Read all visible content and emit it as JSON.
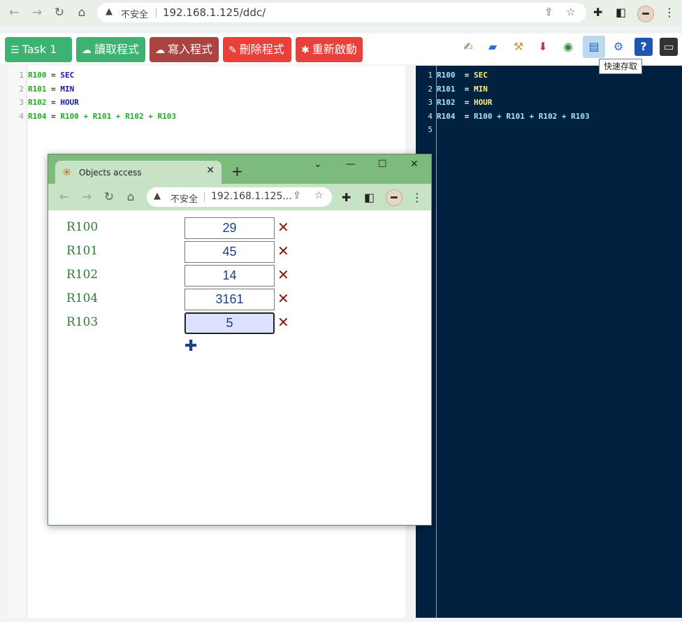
{
  "browser": {
    "security_label": "不安全",
    "url": "192.168.1.125/ddc/"
  },
  "toolbar": {
    "task_label": "Task 1",
    "read_label": "讀取程式",
    "write_label": "寫入程式",
    "delete_label": "刪除程式",
    "restart_label": "重新啟動",
    "tooltip": "快速存取",
    "colors": {
      "green": "#3cb371",
      "maroon": "#a94442",
      "red": "#e8413c"
    }
  },
  "editor_left": {
    "lines": [
      {
        "num": "1",
        "reg": "R100",
        "eq": " = ",
        "rhs": "SEC"
      },
      {
        "num": "2",
        "reg": "R101",
        "eq": " = ",
        "rhs": "MIN"
      },
      {
        "num": "3",
        "reg": "R102",
        "eq": " = ",
        "rhs": "HOUR"
      },
      {
        "num": "4",
        "reg": "R104",
        "eq": " = ",
        "rhs": "R100 + R101 + R102 + R103"
      }
    ]
  },
  "editor_right": {
    "lines": [
      {
        "num": "1",
        "reg": "R100",
        "eq": "  = ",
        "rhs": "SEC"
      },
      {
        "num": "2",
        "reg": "R101",
        "eq": "  = ",
        "rhs": "MIN"
      },
      {
        "num": "3",
        "reg": "R102",
        "eq": "  = ",
        "rhs": "HOUR"
      },
      {
        "num": "4",
        "reg": "R104",
        "eq": "  = ",
        "rhs": "R100 + R101 + R102 + R103"
      },
      {
        "num": "5",
        "reg": "",
        "eq": "",
        "rhs": ""
      }
    ]
  },
  "popup": {
    "tab_title": "Objects access",
    "security_label": "不安全",
    "url": "192.168.1.125...",
    "objects": [
      {
        "name": "R100",
        "value": "29"
      },
      {
        "name": "R101",
        "value": "45"
      },
      {
        "name": "R102",
        "value": "14"
      },
      {
        "name": "R104",
        "value": "3161"
      },
      {
        "name": "R103",
        "value": "5"
      }
    ]
  }
}
